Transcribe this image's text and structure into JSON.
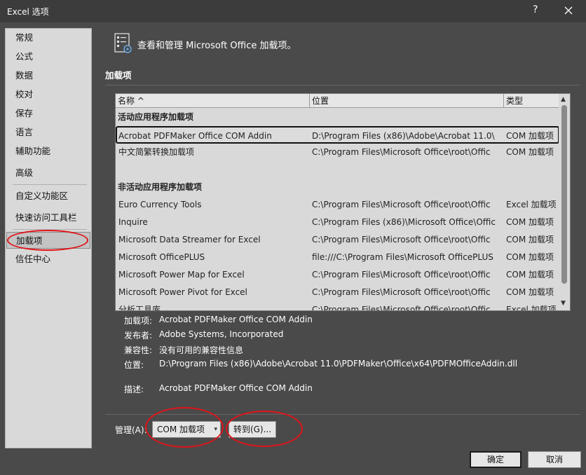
{
  "window": {
    "title": "Excel 选项",
    "help": "?"
  },
  "sidebar": {
    "items": [
      "常规",
      "公式",
      "数据",
      "校对",
      "保存",
      "语言",
      "辅助功能",
      "高级",
      "自定义功能区",
      "快速访问工具栏",
      "加载项",
      "信任中心"
    ],
    "selected": "加载项"
  },
  "header": {
    "text": "查看和管理 Microsoft Office 加载项。"
  },
  "section": {
    "title": "加载项"
  },
  "table": {
    "columns": [
      "名称 ^",
      "位置",
      "类型"
    ],
    "groups": [
      {
        "title": "活动应用程序加载项",
        "rows": [
          {
            "name": "Acrobat PDFMaker Office COM Addin",
            "location": "D:\\Program Files (x86)\\Adobe\\Acrobat 11.0\\",
            "type": "COM 加载项"
          },
          {
            "name": "中文简繁转换加载项",
            "location": "C:\\Program Files\\Microsoft Office\\root\\Offic",
            "type": "COM 加载项"
          }
        ]
      },
      {
        "title": "非活动应用程序加载项",
        "rows": [
          {
            "name": "Euro Currency Tools",
            "location": "C:\\Program Files\\Microsoft Office\\root\\Offic",
            "type": "Excel 加载项"
          },
          {
            "name": "Inquire",
            "location": "C:\\Program Files (x86)\\Microsoft Office\\Offic",
            "type": "COM 加载项"
          },
          {
            "name": "Microsoft Data Streamer for Excel",
            "location": "C:\\Program Files\\Microsoft Office\\root\\Offic",
            "type": "COM 加载项"
          },
          {
            "name": "Microsoft OfficePLUS",
            "location": "file:///C:\\Program Files\\Microsoft OfficePLUS",
            "type": "COM 加载项"
          },
          {
            "name": "Microsoft Power Map for Excel",
            "location": "C:\\Program Files\\Microsoft Office\\root\\Offic",
            "type": "COM 加载项"
          },
          {
            "name": "Microsoft Power Pivot for Excel",
            "location": "C:\\Program Files\\Microsoft Office\\root\\Offic",
            "type": "COM 加载项"
          },
          {
            "name": "分析工具库",
            "location": "C:\\Program Files\\Microsoft Office\\root\\Offic",
            "type": "Excel 加载项"
          }
        ]
      }
    ]
  },
  "details": {
    "addin_label": "加载项:",
    "addin_value": "Acrobat PDFMaker Office COM Addin",
    "publisher_label": "发布者:",
    "publisher_value": "Adobe Systems, Incorporated",
    "compat_label": "兼容性:",
    "compat_value": "没有可用的兼容性信息",
    "location_label": "位置:",
    "location_value": "D:\\Program Files (x86)\\Adobe\\Acrobat 11.0\\PDFMaker\\Office\\x64\\PDFMOfficeAddin.dll",
    "desc_label": "描述:",
    "desc_value": "Acrobat PDFMaker Office COM Addin"
  },
  "manage": {
    "label": "管理(A):",
    "select_value": "COM 加载项",
    "go_button": "转到(G)..."
  },
  "footer": {
    "ok": "确定",
    "cancel": "取消"
  },
  "colors": {
    "dialog_bg": "#4a4a4a",
    "panel_bg": "#d9d9d9",
    "highlight_annotation": "#e0141a"
  }
}
